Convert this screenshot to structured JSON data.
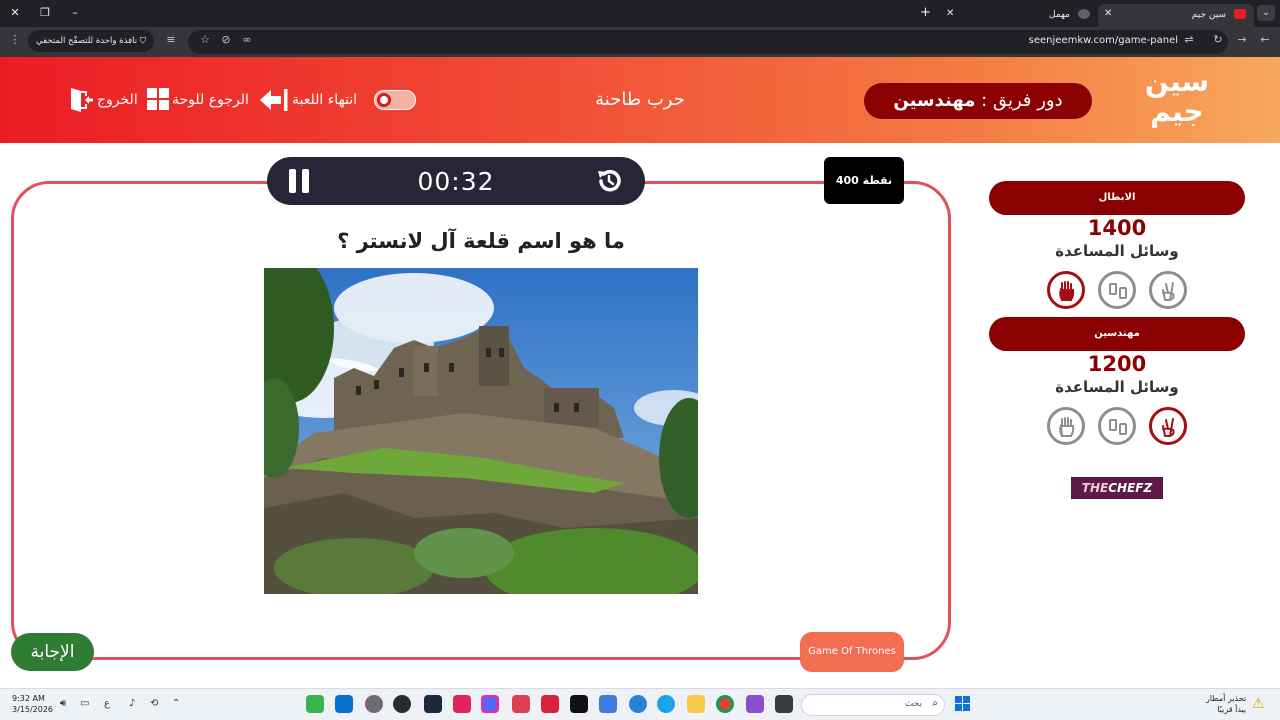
{
  "browser": {
    "tabs": [
      {
        "label": "سين جيم",
        "active": true
      },
      {
        "label": "مهمل",
        "active": false
      }
    ],
    "url": "seenjeemkw.com/game-panel",
    "incognito_chip": "نافذة واحدة للتصفّح المتخفي"
  },
  "header": {
    "logo_line1": "سين",
    "logo_line2": "جيم",
    "turn_prefix": "دور فريق :",
    "turn_team": "مهندسين",
    "category_title": "حرب طاحنة",
    "end_game_label": "انتهاء اللعبة",
    "back_to_board_label": "الرجوع للوحة",
    "exit_label": "الخروج"
  },
  "game": {
    "timer": "00:32",
    "points": "400 نقطة",
    "question": "ما هو اسم قلعة آل لانستر ؟",
    "category_button": "Game Of Thrones",
    "answer_button": "الإجابة"
  },
  "teams": [
    {
      "name": "الابطال",
      "score": "1400",
      "aids_label": "وسائل المساعدة",
      "aids": [
        {
          "icon": "two-fingers-icon",
          "used": false
        },
        {
          "icon": "phone-hands-icon",
          "used": false
        },
        {
          "icon": "stop-hand-icon",
          "used": true
        }
      ]
    },
    {
      "name": "مهندسين",
      "score": "1200",
      "aids_label": "وسائل المساعدة",
      "aids": [
        {
          "icon": "two-fingers-icon",
          "used": true
        },
        {
          "icon": "phone-hands-icon",
          "used": false
        },
        {
          "icon": "stop-hand-icon",
          "used": false
        }
      ]
    }
  ],
  "sponsor": {
    "part1": "THE",
    "part2": "CHEFZ"
  },
  "taskbar": {
    "time": "9:32 AM",
    "date": "3/15/2026",
    "lang": "ع",
    "search_placeholder": "بحث",
    "weather_line1": "تحذير أمطار",
    "weather_line2": "يبدأ قريبًا"
  },
  "colors": {
    "header_start": "#ec1c24",
    "header_end": "#f7a85e",
    "dark_red": "#8b0000",
    "panel_border": "#e0505e",
    "answer_green": "#2e7d32",
    "category_orange": "#f06d50"
  }
}
